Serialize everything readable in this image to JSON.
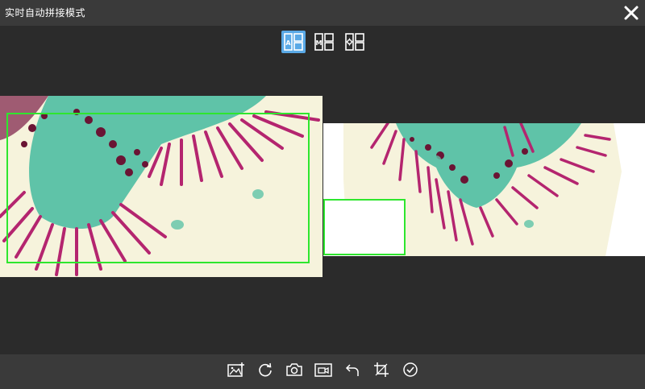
{
  "window": {
    "title": "实时自动拼接模式"
  },
  "modes": [
    {
      "name": "auto-mode",
      "letter": "A",
      "active": true
    },
    {
      "name": "manual-mode",
      "letter": "M",
      "active": false
    },
    {
      "name": "settings-mode",
      "letter": "",
      "active": false
    }
  ],
  "toolbar": {
    "icons": [
      "add-image-icon",
      "refresh-icon",
      "camera-icon",
      "record-video-icon",
      "undo-icon",
      "crop-icon",
      "confirm-icon"
    ]
  },
  "colors": {
    "background": "#2b2b2b",
    "bars": "#3a3a3a",
    "accent": "#5aa9e6",
    "selection": "#2ee62e",
    "tissue_magenta": "#b4256f",
    "tissue_teal": "#5fc3a8",
    "tissue_background": "#f6f3dc"
  }
}
